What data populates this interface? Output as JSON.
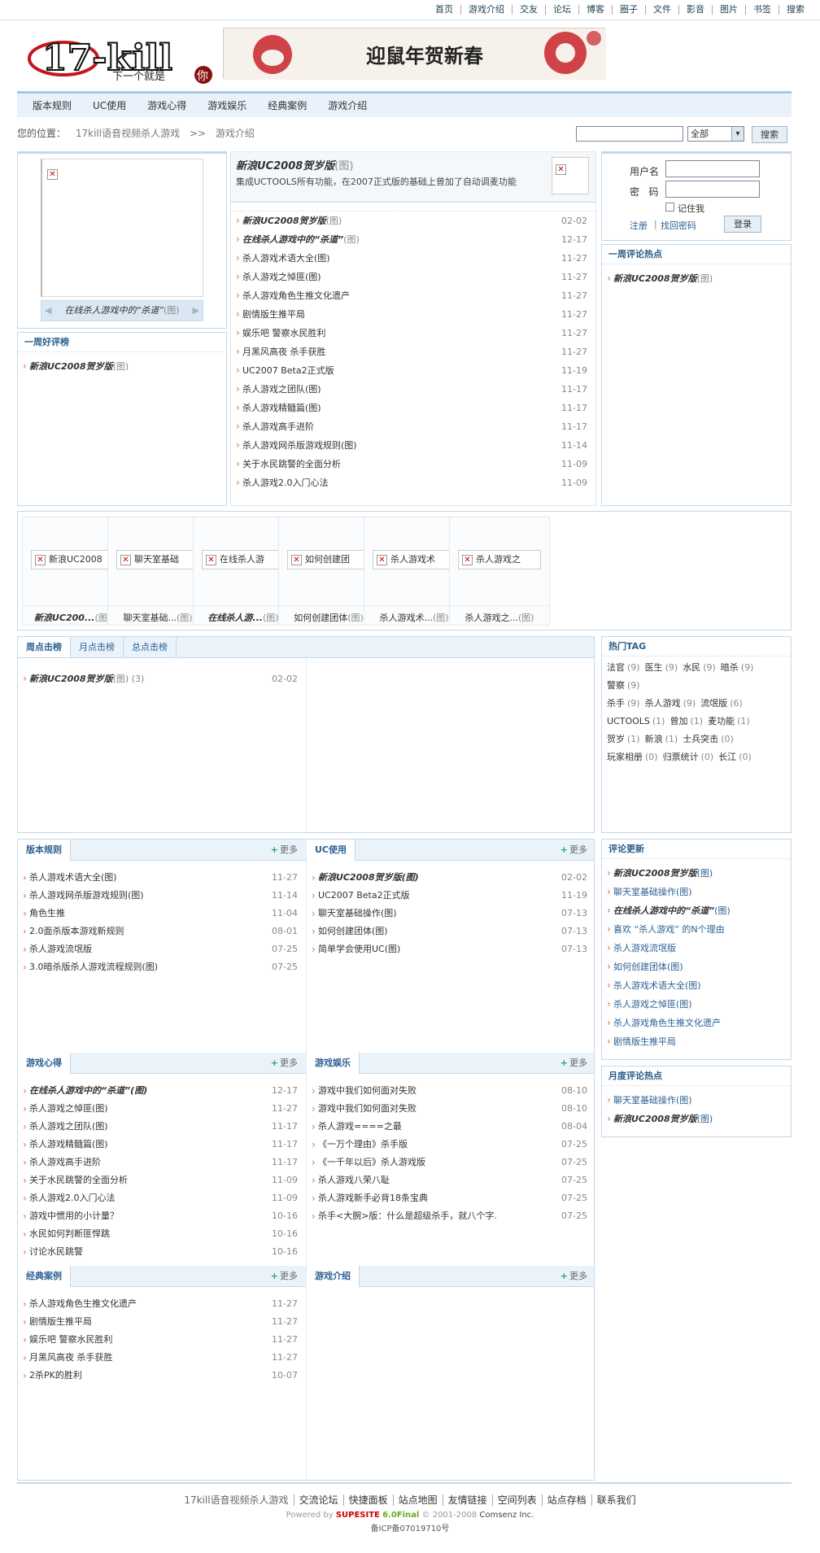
{
  "topnav": [
    "首页",
    "游戏介绍",
    "交友",
    "论坛",
    "博客",
    "圈子",
    "文件",
    "影音",
    "图片",
    "书签",
    "搜索"
  ],
  "logo": {
    "text": "17-kill",
    "slogan": "下一个就是",
    "seal": "你"
  },
  "banner": {
    "text": "迎鼠年贺新春"
  },
  "catnav": [
    "版本规则",
    "UC使用",
    "游戏心得",
    "游戏娱乐",
    "经典案例",
    "游戏介绍"
  ],
  "crumb": {
    "label": "您的位置：",
    "site": "17kill语音视频杀人游戏",
    "sep": ">>",
    "current": "游戏介绍"
  },
  "search": {
    "select": "全部",
    "button": "搜索"
  },
  "slideshow": {
    "caption": "在线杀人游戏中的“杀道”",
    "suffix": "(图)"
  },
  "weekly_good": {
    "title": "一周好评榜",
    "items": [
      {
        "text": "新浪UC2008贺岁版",
        "suffix": "(图)"
      }
    ]
  },
  "headline": {
    "title": "新浪UC2008贺岁版",
    "suffix": "(图)",
    "desc": "集成UCTOOLS所有功能，在2007正式版的基础上曾加了自动调麦功能"
  },
  "news": [
    {
      "t": "新浪UC2008贺岁版",
      "s": "(图)",
      "d": "02-02",
      "it": true
    },
    {
      "t": "在线杀人游戏中的“杀道”",
      "s": "(图)",
      "d": "12-17",
      "it": true
    },
    {
      "t": "杀人游戏术语大全(图)",
      "s": "",
      "d": "11-27"
    },
    {
      "t": "杀人游戏之悼匪(图)",
      "s": "",
      "d": "11-27"
    },
    {
      "t": "杀人游戏角色生推文化遗产",
      "s": "",
      "d": "11-27"
    },
    {
      "t": "剧情版生推平局",
      "s": "",
      "d": "11-27"
    },
    {
      "t": "娱乐吧  警察水民胜利",
      "s": "",
      "d": "11-27"
    },
    {
      "t": "月黑风高夜  杀手获胜",
      "s": "",
      "d": "11-27"
    },
    {
      "t": "UC2007 Beta2正式版",
      "s": "",
      "d": "11-19"
    },
    {
      "t": "杀人游戏之团队(图)",
      "s": "",
      "d": "11-17"
    },
    {
      "t": "杀人游戏精髓篇(图)",
      "s": "",
      "d": "11-17"
    },
    {
      "t": "杀人游戏高手进阶",
      "s": "",
      "d": "11-17"
    },
    {
      "t": "杀人游戏网杀版游戏规则(图)",
      "s": "",
      "d": "11-14"
    },
    {
      "t": "关于水民跳警的全面分析",
      "s": "",
      "d": "11-09"
    },
    {
      "t": "杀人游戏2.0入门心法",
      "s": "",
      "d": "11-09"
    }
  ],
  "login": {
    "user_label": "用户名",
    "pass_label": "密   码",
    "remember": "记住我",
    "register": "注册",
    "sep": "|",
    "forgot": "找回密码",
    "button": "登录"
  },
  "weekly_comment": {
    "title": "一周评论热点",
    "items": [
      {
        "text": "新浪UC2008贺岁版",
        "suffix": "(图)"
      }
    ]
  },
  "thumbs": [
    {
      "img": "新浪UC2008",
      "cap": "新浪UC200...",
      "s": "(图)",
      "it": true
    },
    {
      "img": "聊天室基础",
      "cap": "聊天室基础...",
      "s": "(图)"
    },
    {
      "img": "在线杀人游",
      "cap": "在线杀人游...",
      "s": "(图)",
      "it": true
    },
    {
      "img": "如何创建团",
      "cap": "如何创建团体",
      "s": "(图)"
    },
    {
      "img": "杀人游戏术",
      "cap": "杀人游戏术...",
      "s": "(图)"
    },
    {
      "img": "杀人游戏之",
      "cap": "杀人游戏之...",
      "s": "(图)"
    }
  ],
  "ranking": {
    "tabs": [
      "周点击榜",
      "月点击榜",
      "总点击榜"
    ],
    "items": [
      {
        "t": "新浪UC2008贺岁版",
        "s": "(图)",
        "n": "(3)",
        "d": "02-02"
      }
    ]
  },
  "hot_tags": {
    "title": "热门TAG",
    "rows": [
      [
        [
          "法官",
          "(9)"
        ],
        [
          "医生",
          "(9)"
        ],
        [
          "水民",
          "(9)"
        ],
        [
          "暗杀",
          "(9)"
        ],
        [
          "警察",
          "(9)"
        ]
      ],
      [
        [
          "杀手",
          "(9)"
        ],
        [
          "杀人游戏",
          "(9)"
        ],
        [
          "流氓版",
          "(6)"
        ]
      ],
      [
        [
          "UCTOOLS",
          "(1)"
        ],
        [
          "曾加",
          "(1)"
        ],
        [
          "麦功能",
          "(1)"
        ]
      ],
      [
        [
          "贺岁",
          "(1)"
        ],
        [
          "新浪",
          "(1)"
        ],
        [
          "士兵突击",
          "(0)"
        ]
      ],
      [
        [
          "玩家相册",
          "(0)"
        ],
        [
          "归票统计",
          "(0)"
        ],
        [
          "长江",
          "(0)"
        ]
      ]
    ]
  },
  "more_label": "更多",
  "sections": [
    {
      "title": "版本规则",
      "items": [
        [
          "杀人游戏术语大全(图)",
          "11-27"
        ],
        [
          "杀人游戏网杀版游戏规则(图)",
          "11-14"
        ],
        [
          "角色生推",
          "11-04"
        ],
        [
          "2.0面杀版本游戏新规则",
          "08-01"
        ],
        [
          "杀人游戏流氓版",
          "07-25"
        ],
        [
          "3.0暗杀版杀人游戏流程规则(图)",
          "07-25"
        ]
      ]
    },
    {
      "title": "UC使用",
      "items": [
        [
          "新浪UC2008贺岁版(图)",
          "02-02"
        ],
        [
          "UC2007 Beta2正式版",
          "11-19"
        ],
        [
          "聊天室基础操作(图)",
          "07-13"
        ],
        [
          "如何创建团体(图)",
          "07-13"
        ],
        [
          "简单学会使用UC(图)",
          "07-13"
        ]
      ]
    },
    {
      "title": "游戏心得",
      "items": [
        [
          "在线杀人游戏中的“杀道”(图)",
          "12-17"
        ],
        [
          "杀人游戏之悼匪(图)",
          "11-27"
        ],
        [
          "杀人游戏之团队(图)",
          "11-17"
        ],
        [
          "杀人游戏精髓篇(图)",
          "11-17"
        ],
        [
          "杀人游戏高手进阶",
          "11-17"
        ],
        [
          "关于水民跳警的全面分析",
          "11-09"
        ],
        [
          "杀人游戏2.0入门心法",
          "11-09"
        ],
        [
          "游戏中惯用的小计量？",
          "10-16"
        ],
        [
          "水民如何判断匪悍跳",
          "10-16"
        ],
        [
          "讨论水民跳警",
          "10-16"
        ]
      ]
    },
    {
      "title": "游戏娱乐",
      "items": [
        [
          "游戏中我们如何面对失败",
          "08-10"
        ],
        [
          "游戏中我们如何面对失败",
          "08-10"
        ],
        [
          "杀人游戏====之最",
          "08-04"
        ],
        [
          "《一万个理由》杀手版",
          "07-25"
        ],
        [
          "《一千年以后》杀人游戏版",
          "07-25"
        ],
        [
          "杀人游戏八荣八耻",
          "07-25"
        ],
        [
          "杀人游戏新手必背18条宝典",
          "07-25"
        ],
        [
          "杀手<大腕>版：什么是超级杀手，就八个字.",
          "07-25"
        ]
      ]
    },
    {
      "title": "经典案例",
      "items": [
        [
          "杀人游戏角色生推文化遗产",
          "11-27"
        ],
        [
          "剧情版生推平局",
          "11-27"
        ],
        [
          "娱乐吧  警察水民胜利",
          "11-27"
        ],
        [
          "月黑风高夜  杀手获胜",
          "11-27"
        ],
        [
          "2杀PK的胜利",
          "10-07"
        ]
      ]
    },
    {
      "title": "游戏介绍",
      "items": []
    }
  ],
  "comment_update": {
    "title": "评论更新",
    "items": [
      {
        "t": "新浪UC2008贺岁版",
        "s": "(图)",
        "it": true
      },
      {
        "t": "聊天室基础操作(图)",
        "s": ""
      },
      {
        "t": "在线杀人游戏中的“杀道”",
        "s": "(图)",
        "it": true
      },
      {
        "t": "喜欢 “杀人游戏” 的N个理由",
        "s": ""
      },
      {
        "t": "杀人游戏流氓版",
        "s": ""
      },
      {
        "t": "如何创建团体(图)",
        "s": ""
      },
      {
        "t": "杀人游戏术语大全(图)",
        "s": ""
      },
      {
        "t": "杀人游戏之悼匪(图)",
        "s": ""
      },
      {
        "t": "杀人游戏角色生推文化遗产",
        "s": ""
      },
      {
        "t": "剧情版生推平局",
        "s": ""
      }
    ]
  },
  "monthly_comment": {
    "title": "月度评论热点",
    "items": [
      {
        "t": "聊天室基础操作(图)",
        "s": ""
      },
      {
        "t": "新浪UC2008贺岁版",
        "s": "(图)",
        "it": true
      }
    ]
  },
  "footer": {
    "links": [
      "17kill语音视频杀人游戏",
      "交流论坛",
      "快捷面板",
      "站点地图",
      "友情链接",
      "空间列表",
      "站点存档",
      "联系我们"
    ],
    "powered": "Powered by",
    "brand": "SUPESITE",
    "version": "6.0Final",
    "copy": "© 2001-2008",
    "company": "Comsenz Inc.",
    "icp": "备ICP备07019710号"
  },
  "colors": {
    "accent": "#2b5f93",
    "border": "#c4d8ea",
    "nav_bg": "#e9f2fa",
    "logo_red": "#c4161c"
  }
}
